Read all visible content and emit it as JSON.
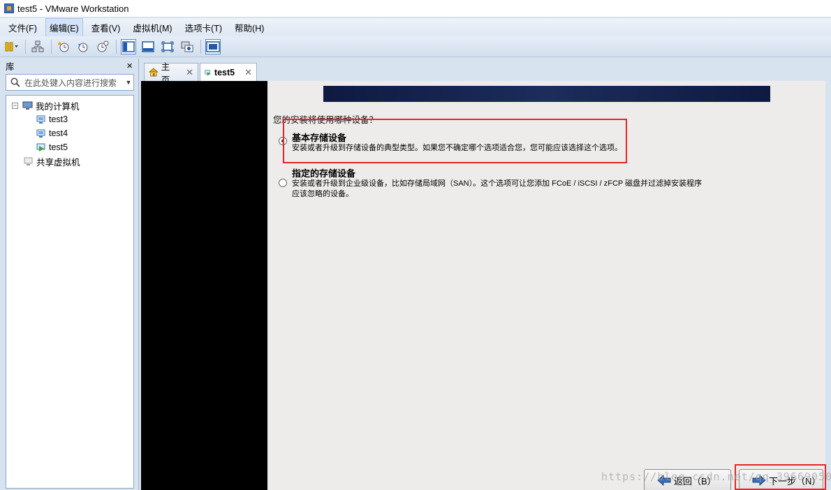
{
  "window": {
    "title": "test5 - VMware Workstation"
  },
  "menu": [
    "文件(F)",
    "编辑(E)",
    "查看(V)",
    "虚拟机(M)",
    "选项卡(T)",
    "帮助(H)"
  ],
  "toolbar": {
    "icons": [
      "pause-icon",
      "network-icon",
      "snapshot-icon",
      "revert-icon",
      "snapshot-manager-icon",
      "normal-view-icon",
      "quick-switch-icon",
      "fullscreen-icon",
      "unity-icon",
      "console-view-icon"
    ]
  },
  "library": {
    "title": "库",
    "close": "×",
    "search_placeholder": "在此处键入内容进行搜索",
    "tree": {
      "root": "我的计算机",
      "vms": [
        "test3",
        "test4",
        "test5"
      ],
      "shared": "共享虚拟机"
    }
  },
  "tabs": [
    {
      "label": "主页",
      "active": false
    },
    {
      "label": "test5",
      "active": true
    }
  ],
  "installer": {
    "question": "您的安装将使用哪种设备？",
    "options": [
      {
        "title": "基本存储设备",
        "desc": [
          "安装或者升级到存储设备的典型类型。如果您不确定哪个选项适合您，您可能应该选择这个选项。"
        ],
        "selected": true
      },
      {
        "title": "指定的存储设备",
        "desc": [
          "安装或者升级到企业级设备，比如存储局域网（SAN）。这个选项可让您添加 FCoE / iSCSI / zFCP 磁盘并过滤掉安装程序",
          "应该忽略的设备。"
        ],
        "selected": false
      }
    ],
    "back_label": "返回（B）",
    "next_label": "下一步（N）",
    "watermark": "https://blog.csdn.net/qq_39669050"
  },
  "colors": {
    "highlight": "#e0262a",
    "banner": "#1c2d5c"
  }
}
